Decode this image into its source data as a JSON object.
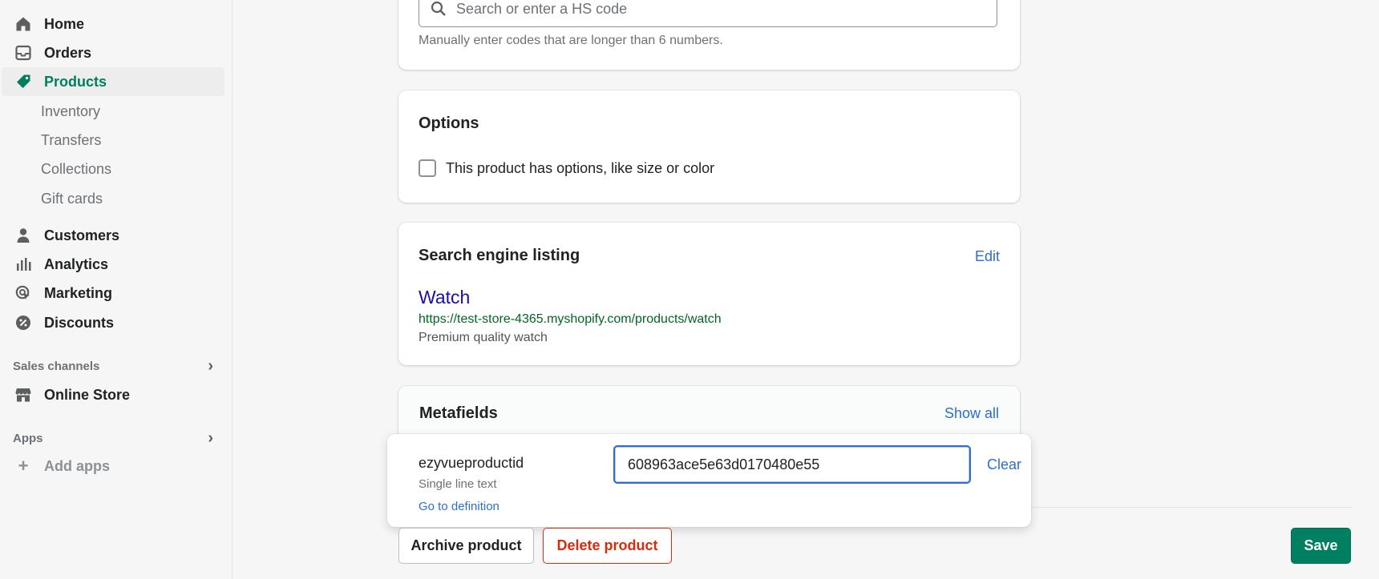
{
  "sidebar": {
    "nav": [
      {
        "label": "Home",
        "icon": "home-icon"
      },
      {
        "label": "Orders",
        "icon": "orders-icon"
      },
      {
        "label": "Products",
        "icon": "tag-icon"
      }
    ],
    "products_sub": [
      "Inventory",
      "Transfers",
      "Collections",
      "Gift cards"
    ],
    "nav2": [
      {
        "label": "Customers",
        "icon": "person-icon"
      },
      {
        "label": "Analytics",
        "icon": "bar-chart-icon"
      },
      {
        "label": "Marketing",
        "icon": "target-icon"
      },
      {
        "label": "Discounts",
        "icon": "discount-icon"
      }
    ],
    "sales_channels_label": "Sales channels",
    "online_store_label": "Online Store",
    "apps_label": "Apps",
    "add_apps_label": "Add apps"
  },
  "hs_code": {
    "placeholder": "Search or enter a HS code",
    "help_text": "Manually enter codes that are longer than 6 numbers."
  },
  "options": {
    "title": "Options",
    "checkbox_label": "This product has options, like size or color",
    "checked": false
  },
  "seo": {
    "title": "Search engine listing",
    "edit_label": "Edit",
    "page_title": "Watch",
    "url": "https://test-store-4365.myshopify.com/products/watch",
    "description": "Premium quality watch"
  },
  "metafields": {
    "title": "Metafields",
    "show_all_label": "Show all",
    "field_name": "ezyvueproductid",
    "field_type": "Single line text",
    "definition_link": "Go to definition",
    "field_value": "608963ace5e63d0170480e55",
    "clear_label": "Clear"
  },
  "actions": {
    "archive_label": "Archive product",
    "delete_label": "Delete product",
    "save_label": "Save"
  },
  "colors": {
    "accent_green": "#008060",
    "active_nav_green": "#007f5f",
    "link_blue": "#2c6ecb",
    "delete_red": "#d72c0d",
    "seo_title_blue": "#1a0dab",
    "seo_url_green": "#006621"
  }
}
